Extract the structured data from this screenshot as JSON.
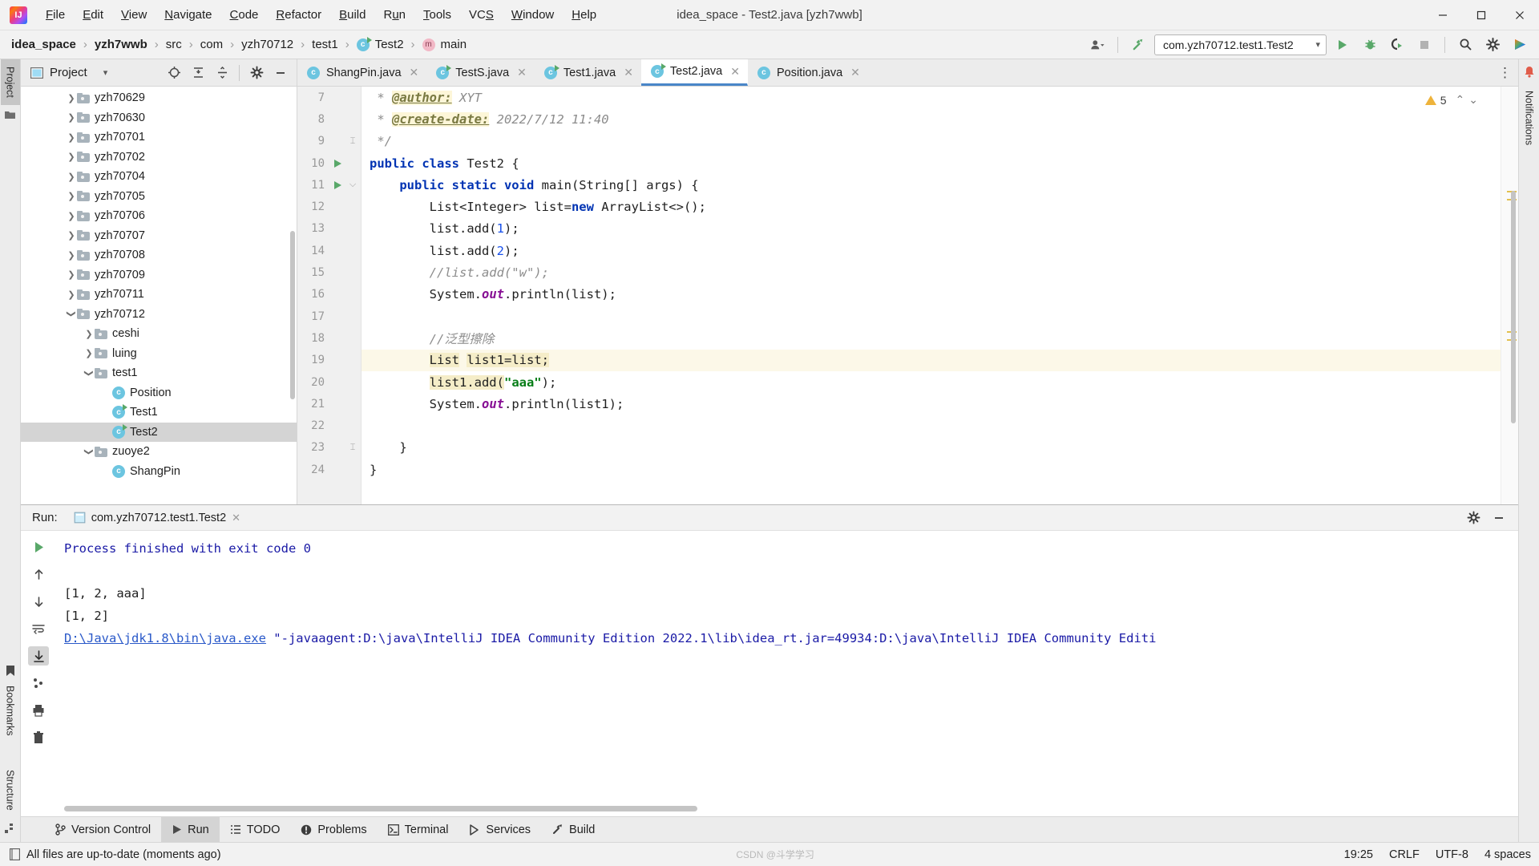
{
  "window": {
    "title": "idea_space - Test2.java [yzh7wwb]",
    "logo_text": "IJ",
    "minimize": "─",
    "maximize": "☐",
    "close": "✕"
  },
  "menu": {
    "items": [
      {
        "label": "File",
        "mnemonic": "F"
      },
      {
        "label": "Edit",
        "mnemonic": "E"
      },
      {
        "label": "View",
        "mnemonic": "V"
      },
      {
        "label": "Navigate",
        "mnemonic": "N"
      },
      {
        "label": "Code",
        "mnemonic": "C"
      },
      {
        "label": "Refactor",
        "mnemonic": "R"
      },
      {
        "label": "Build",
        "mnemonic": "B"
      },
      {
        "label": "Run",
        "mnemonic": "u"
      },
      {
        "label": "Tools",
        "mnemonic": "T"
      },
      {
        "label": "VCS",
        "mnemonic": "S"
      },
      {
        "label": "Window",
        "mnemonic": "W"
      },
      {
        "label": "Help",
        "mnemonic": "H"
      }
    ]
  },
  "breadcrumb": {
    "separator": "›",
    "items": [
      {
        "label": "idea_space",
        "bold": true,
        "icon": ""
      },
      {
        "label": "yzh7wwb",
        "bold": true,
        "icon": ""
      },
      {
        "label": "src",
        "bold": false,
        "icon": ""
      },
      {
        "label": "com",
        "bold": false,
        "icon": ""
      },
      {
        "label": "yzh70712",
        "bold": false,
        "icon": ""
      },
      {
        "label": "test1",
        "bold": false,
        "icon": ""
      },
      {
        "label": "Test2",
        "bold": false,
        "icon": "class-icon"
      },
      {
        "label": "main",
        "bold": false,
        "icon": "method-icon"
      }
    ]
  },
  "toolbar": {
    "run_config": "com.yzh70712.test1.Test2",
    "run_config_caret": "▾",
    "user_icon": "user-icon",
    "build_icon": "hammer-icon",
    "run_icon": "run-icon",
    "debug_icon": "debug-icon",
    "run_coverage_icon": "run-with-coverage-icon",
    "stop_icon": "stop-icon",
    "search_icon": "search-icon",
    "settings_icon": "gear-icon",
    "updates_icon": "ide-updates-icon"
  },
  "project_panel": {
    "title": "Project",
    "dropdown_caret": "▾",
    "icons": [
      "locate-icon",
      "expand-all-icon",
      "collapse-all-icon",
      "gear-icon",
      "hide-icon"
    ],
    "tree": [
      {
        "label": "yzh70629",
        "type": "folder",
        "indent": 2,
        "arrow": "collapsed"
      },
      {
        "label": "yzh70630",
        "type": "folder",
        "indent": 2,
        "arrow": "collapsed"
      },
      {
        "label": "yzh70701",
        "type": "folder",
        "indent": 2,
        "arrow": "collapsed"
      },
      {
        "label": "yzh70702",
        "type": "folder",
        "indent": 2,
        "arrow": "collapsed"
      },
      {
        "label": "yzh70704",
        "type": "folder",
        "indent": 2,
        "arrow": "collapsed"
      },
      {
        "label": "yzh70705",
        "type": "folder",
        "indent": 2,
        "arrow": "collapsed"
      },
      {
        "label": "yzh70706",
        "type": "folder",
        "indent": 2,
        "arrow": "collapsed"
      },
      {
        "label": "yzh70707",
        "type": "folder",
        "indent": 2,
        "arrow": "collapsed"
      },
      {
        "label": "yzh70708",
        "type": "folder",
        "indent": 2,
        "arrow": "collapsed"
      },
      {
        "label": "yzh70709",
        "type": "folder",
        "indent": 2,
        "arrow": "collapsed"
      },
      {
        "label": "yzh70711",
        "type": "folder",
        "indent": 2,
        "arrow": "collapsed"
      },
      {
        "label": "yzh70712",
        "type": "folder",
        "indent": 2,
        "arrow": "expanded"
      },
      {
        "label": "ceshi",
        "type": "folder",
        "indent": 3,
        "arrow": "collapsed"
      },
      {
        "label": "luing",
        "type": "folder",
        "indent": 3,
        "arrow": "collapsed"
      },
      {
        "label": "test1",
        "type": "folder",
        "indent": 3,
        "arrow": "expanded"
      },
      {
        "label": "Position",
        "type": "class",
        "indent": 4,
        "arrow": "none"
      },
      {
        "label": "Test1",
        "type": "class-runnable",
        "indent": 4,
        "arrow": "none"
      },
      {
        "label": "Test2",
        "type": "class-runnable",
        "indent": 4,
        "arrow": "none",
        "selected": true
      },
      {
        "label": "zuoye2",
        "type": "folder",
        "indent": 3,
        "arrow": "expanded"
      },
      {
        "label": "ShangPin",
        "type": "class",
        "indent": 4,
        "arrow": "none"
      }
    ]
  },
  "editor": {
    "tabs": [
      {
        "label": "ShangPin.java",
        "icon": "class-icon",
        "active": false
      },
      {
        "label": "TestS.java",
        "icon": "class-runnable-icon",
        "active": false
      },
      {
        "label": "Test1.java",
        "icon": "class-runnable-icon",
        "active": false
      },
      {
        "label": "Test2.java",
        "icon": "class-runnable-icon",
        "active": true
      },
      {
        "label": "Position.java",
        "icon": "class-icon",
        "active": false
      }
    ],
    "more_icon": "⋮",
    "warning_count": "5",
    "warning_up": "⌃",
    "warning_down": "⌄",
    "lines": [
      {
        "n": "7",
        "indent": 0,
        "gutter": "",
        "fold": "",
        "tokens": [
          {
            "t": " * ",
            "c": "cmt"
          },
          {
            "t": "@author:",
            "c": "doctag"
          },
          {
            "t": " XYT",
            "c": "docval"
          }
        ]
      },
      {
        "n": "8",
        "indent": 0,
        "gutter": "",
        "fold": "",
        "tokens": [
          {
            "t": " * ",
            "c": "cmt"
          },
          {
            "t": "@create-date:",
            "c": "doctag"
          },
          {
            "t": " 2022/7/12 11:40",
            "c": "docval"
          }
        ]
      },
      {
        "n": "9",
        "indent": 0,
        "gutter": "",
        "fold": "end",
        "tokens": [
          {
            "t": " */",
            "c": "cmt"
          }
        ]
      },
      {
        "n": "10",
        "indent": 0,
        "gutter": "run",
        "fold": "",
        "tokens": [
          {
            "t": "public class ",
            "c": "kw"
          },
          {
            "t": "Test2 {",
            "c": ""
          }
        ]
      },
      {
        "n": "11",
        "indent": 0,
        "gutter": "run",
        "fold": "start",
        "tokens": [
          {
            "t": "    ",
            "c": ""
          },
          {
            "t": "public static void ",
            "c": "kw"
          },
          {
            "t": "main(String[] args) {",
            "c": ""
          }
        ]
      },
      {
        "n": "12",
        "indent": 0,
        "gutter": "",
        "fold": "",
        "tokens": [
          {
            "t": "        List<Integer> list=",
            "c": ""
          },
          {
            "t": "new ",
            "c": "kw"
          },
          {
            "t": "ArrayList<>();",
            "c": ""
          }
        ]
      },
      {
        "n": "13",
        "indent": 0,
        "gutter": "",
        "fold": "",
        "tokens": [
          {
            "t": "        list.add(",
            "c": ""
          },
          {
            "t": "1",
            "c": "num"
          },
          {
            "t": ");",
            "c": ""
          }
        ]
      },
      {
        "n": "14",
        "indent": 0,
        "gutter": "",
        "fold": "",
        "tokens": [
          {
            "t": "        list.add(",
            "c": ""
          },
          {
            "t": "2",
            "c": "num"
          },
          {
            "t": ");",
            "c": ""
          }
        ]
      },
      {
        "n": "15",
        "indent": 0,
        "gutter": "",
        "fold": "",
        "tokens": [
          {
            "t": "        //list.add(\"w\");",
            "c": "cmt"
          }
        ]
      },
      {
        "n": "16",
        "indent": 0,
        "gutter": "",
        "fold": "",
        "tokens": [
          {
            "t": "        System.",
            "c": ""
          },
          {
            "t": "out",
            "c": "fld"
          },
          {
            "t": ".println(list);",
            "c": ""
          }
        ]
      },
      {
        "n": "17",
        "indent": 0,
        "gutter": "",
        "fold": "",
        "tokens": []
      },
      {
        "n": "18",
        "indent": 0,
        "gutter": "",
        "fold": "",
        "tokens": [
          {
            "t": "        //泛型擦除",
            "c": "cmt"
          }
        ]
      },
      {
        "n": "19",
        "indent": 0,
        "gutter": "",
        "fold": "",
        "highlight": true,
        "tokens": [
          {
            "t": "        ",
            "c": ""
          },
          {
            "t": "List",
            "c": "hlbox"
          },
          {
            "t": " ",
            "c": ""
          },
          {
            "t": "list1=list;",
            "c": "hlbox"
          }
        ]
      },
      {
        "n": "20",
        "indent": 0,
        "gutter": "",
        "fold": "",
        "tokens": [
          {
            "t": "        ",
            "c": ""
          },
          {
            "t": "list1.add(",
            "c": "hlbox"
          },
          {
            "t": "\"aaa\"",
            "c": "str"
          },
          {
            "t": ");",
            "c": ""
          }
        ]
      },
      {
        "n": "21",
        "indent": 0,
        "gutter": "",
        "fold": "",
        "tokens": [
          {
            "t": "        System.",
            "c": ""
          },
          {
            "t": "out",
            "c": "fld"
          },
          {
            "t": ".println(list1);",
            "c": ""
          }
        ]
      },
      {
        "n": "22",
        "indent": 0,
        "gutter": "",
        "fold": "",
        "tokens": []
      },
      {
        "n": "23",
        "indent": 0,
        "gutter": "",
        "fold": "end",
        "tokens": [
          {
            "t": "    }",
            "c": ""
          }
        ]
      },
      {
        "n": "24",
        "indent": 0,
        "gutter": "",
        "fold": "",
        "tokens": [
          {
            "t": "}",
            "c": ""
          }
        ]
      }
    ]
  },
  "run_panel": {
    "label": "Run:",
    "tab_label": "com.yzh70712.test1.Test2",
    "tab_icon": "console-icon",
    "tab_close": "✕",
    "settings_icon": "gear-icon",
    "minimize_icon": "─",
    "toolbar_icons": [
      "rerun-icon",
      "scroll-up-icon",
      "scroll-down-icon",
      "soft-wrap-icon",
      "scroll-to-end-icon",
      "settings-icon",
      "print-icon",
      "clear-all-icon"
    ],
    "console": [
      {
        "segments": [
          {
            "t": "D:\\Java\\jdk1.8\\bin\\java.exe",
            "c": "c-link"
          },
          {
            "t": " \"-javaagent:D:\\java\\IntelliJ IDEA Community Edition 2022.1\\lib\\idea_rt.jar=49934:D:\\java\\IntelliJ IDEA Community Editi",
            "c": "c-blue"
          }
        ]
      },
      {
        "segments": [
          {
            "t": "[1, 2]",
            "c": "c-black"
          }
        ]
      },
      {
        "segments": [
          {
            "t": "[1, 2, aaa]",
            "c": "c-black"
          }
        ]
      },
      {
        "segments": [
          {
            "t": "",
            "c": "c-black"
          }
        ]
      },
      {
        "segments": [
          {
            "t": "Process finished with exit code 0",
            "c": "c-blue"
          }
        ]
      }
    ]
  },
  "rails": {
    "left": [
      {
        "label": "Project",
        "active": true,
        "icon": "project-icon"
      },
      {
        "label": "Bookmarks",
        "active": false,
        "icon": "bookmarks-icon"
      },
      {
        "label": "Structure",
        "active": false,
        "icon": "structure-icon"
      }
    ],
    "right": [
      {
        "label": "Notifications",
        "active": false,
        "icon": "notifications-icon"
      }
    ]
  },
  "bottom_tabs": [
    {
      "label": "Version Control",
      "icon": "branch-icon",
      "active": false
    },
    {
      "label": "Run",
      "icon": "run-icon",
      "active": true
    },
    {
      "label": "TODO",
      "icon": "todo-icon",
      "active": false
    },
    {
      "label": "Problems",
      "icon": "problems-icon",
      "active": false
    },
    {
      "label": "Terminal",
      "icon": "terminal-icon",
      "active": false
    },
    {
      "label": "Services",
      "icon": "services-icon",
      "active": false
    },
    {
      "label": "Build",
      "icon": "build-icon",
      "active": false
    }
  ],
  "statusbar": {
    "message": "All files are up-to-date (moments ago)",
    "icon": "file-status-icon",
    "time": "19:25",
    "line_sep": "CRLF",
    "encoding": "UTF-8",
    "indent": "4 spaces",
    "watermark": "CSDN @斗学学习"
  },
  "colors": {
    "accent_blue": "#4a86c8",
    "green": "#59a869",
    "class_icon": "#6cc5e0",
    "folder": "#a8b3bb",
    "warn": "#eeb33b",
    "highlight_line": "#fcf8e8"
  }
}
